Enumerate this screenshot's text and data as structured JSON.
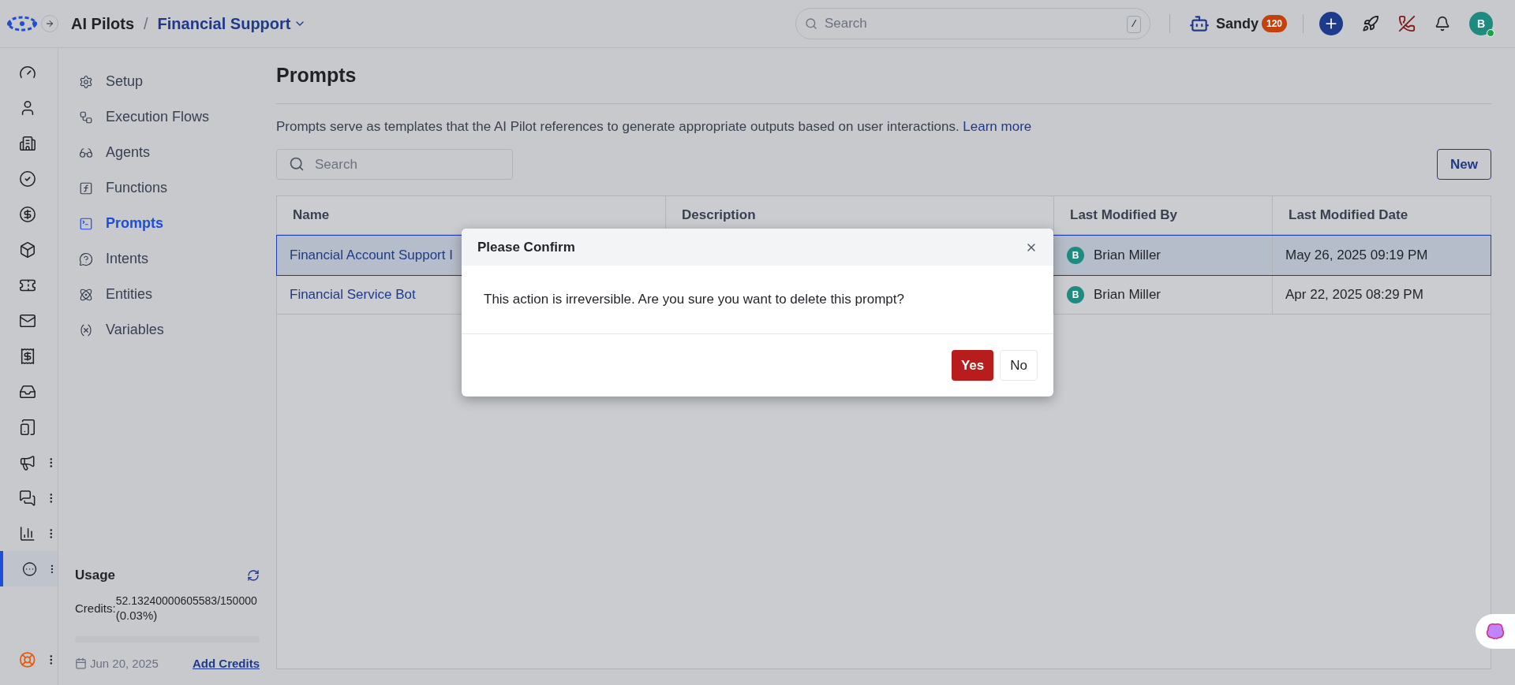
{
  "header": {
    "app": "AI Pilots",
    "separator": "/",
    "workspace": "Financial Support",
    "search": {
      "placeholder": "Search",
      "shortcut": "/"
    },
    "agent": {
      "name": "Sandy",
      "count": "120"
    },
    "avatar": "B"
  },
  "rail": [
    {
      "selected": false,
      "has_menu": false
    },
    {
      "selected": false,
      "has_menu": false
    },
    {
      "selected": false,
      "has_menu": false
    },
    {
      "selected": false,
      "has_menu": false
    },
    {
      "selected": false,
      "has_menu": false
    },
    {
      "selected": false,
      "has_menu": false
    },
    {
      "selected": false,
      "has_menu": false
    },
    {
      "selected": false,
      "has_menu": false
    },
    {
      "selected": false,
      "has_menu": false
    },
    {
      "selected": false,
      "has_menu": false
    },
    {
      "selected": false,
      "has_menu": false
    },
    {
      "selected": false,
      "has_menu": true
    },
    {
      "selected": false,
      "has_menu": true
    },
    {
      "selected": false,
      "has_menu": true
    },
    {
      "selected": true,
      "has_menu": true
    }
  ],
  "nav": [
    {
      "label": "Setup",
      "selected": false
    },
    {
      "label": "Execution Flows",
      "selected": false
    },
    {
      "label": "Agents",
      "selected": false
    },
    {
      "label": "Functions",
      "selected": false
    },
    {
      "label": "Prompts",
      "selected": true
    },
    {
      "label": "Intents",
      "selected": false
    },
    {
      "label": "Entities",
      "selected": false
    },
    {
      "label": "Variables",
      "selected": false
    }
  ],
  "usage": {
    "title": "Usage",
    "credits_label": "Credits:",
    "credits_value": "52.13240000605583/150000",
    "percent": "(0.03%)",
    "level": 0.0003,
    "date": "Jun 20, 2025",
    "add_link": "Add Credits"
  },
  "page": {
    "title": "Prompts",
    "description": "Prompts serve as templates that the AI Pilot references to generate appropriate outputs based on user interactions.",
    "learn_more": "Learn more",
    "search_placeholder": "Search",
    "new_button": "New"
  },
  "table": {
    "columns": [
      "Name",
      "Description",
      "Last Modified By",
      "Last Modified Date"
    ],
    "rows": [
      {
        "name": "Financial Account Support I",
        "user_initial": "B",
        "user": "Brian Miller",
        "date": "May 26, 2025 09:19 PM",
        "selected": true
      },
      {
        "name": "Financial Service Bot",
        "user_initial": "B",
        "user": "Brian Miller",
        "date": "Apr 22, 2025 08:29 PM",
        "selected": false
      }
    ]
  },
  "dialog": {
    "title": "Please Confirm",
    "message": "This action is irreversible. Are you sure you want to delete this prompt?",
    "yes": "Yes",
    "no": "No"
  }
}
